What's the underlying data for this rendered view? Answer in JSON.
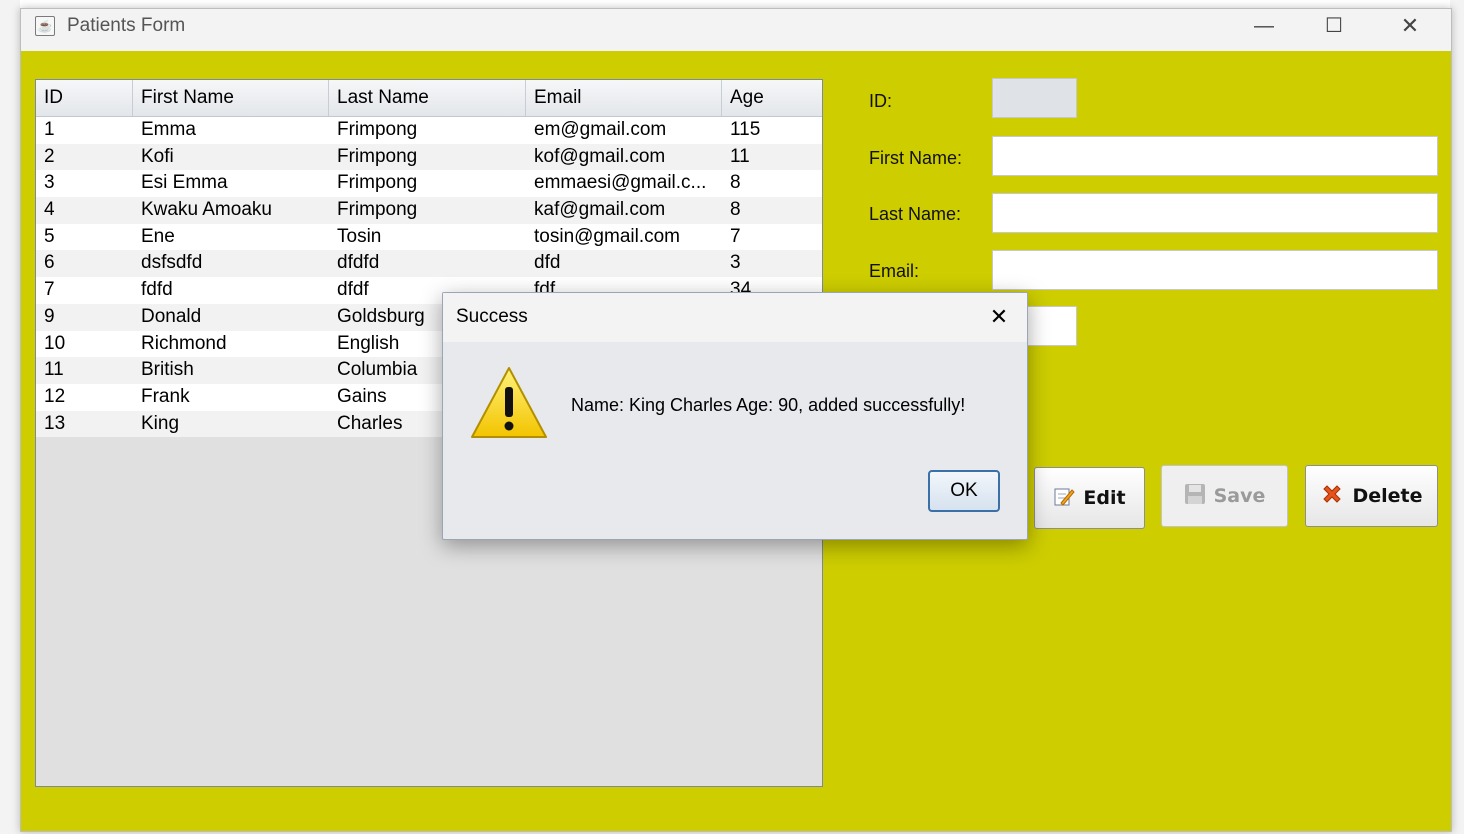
{
  "window": {
    "title": "Patients Form",
    "controls": {
      "minimize": "—",
      "maximize": "☐",
      "close": "✕"
    }
  },
  "table": {
    "headers": [
      "ID",
      "First Name",
      "Last Name",
      "Email",
      "Age"
    ],
    "rows": [
      [
        "1",
        "Emma",
        "Frimpong",
        "em@gmail.com",
        "115"
      ],
      [
        "2",
        "Kofi",
        "Frimpong",
        "kof@gmail.com",
        "11"
      ],
      [
        "3",
        "Esi Emma",
        "Frimpong",
        "emmaesi@gmail.c...",
        "8"
      ],
      [
        "4",
        "Kwaku Amoaku",
        "Frimpong",
        "kaf@gmail.com",
        "8"
      ],
      [
        "5",
        "Ene",
        "Tosin",
        "tosin@gmail.com",
        "7"
      ],
      [
        "6",
        "dsfsdfd",
        "dfdfd",
        "dfd",
        "3"
      ],
      [
        "7",
        "fdfd",
        "dfdf",
        "fdf",
        "34"
      ],
      [
        "9",
        "Donald",
        "Goldsburg",
        "",
        ""
      ],
      [
        "10",
        "Richmond",
        "English",
        "",
        ""
      ],
      [
        "11",
        "British",
        "Columbia",
        "",
        ""
      ],
      [
        "12",
        "Frank",
        "Gains",
        "",
        ""
      ],
      [
        "13",
        "King",
        "Charles",
        "",
        ""
      ]
    ]
  },
  "form": {
    "id_label": "ID:",
    "first_name_label": "First Name:",
    "last_name_label": "Last Name:",
    "email_label": "Email:",
    "id_value": "",
    "first_name_value": "",
    "last_name_value": "",
    "email_value": "",
    "age_value": ""
  },
  "buttons": {
    "edit": "Edit",
    "save": "Save",
    "delete": "Delete"
  },
  "dialog": {
    "title": "Success",
    "message": "Name: King Charles Age: 90, added successfully!",
    "ok": "OK",
    "close": "✕"
  },
  "colors": {
    "window_bg": "#cdcd00",
    "titlebar_bg": "#f3f3f3",
    "dialog_bg": "#e7e9ed",
    "ok_border": "#3b6fa8"
  }
}
